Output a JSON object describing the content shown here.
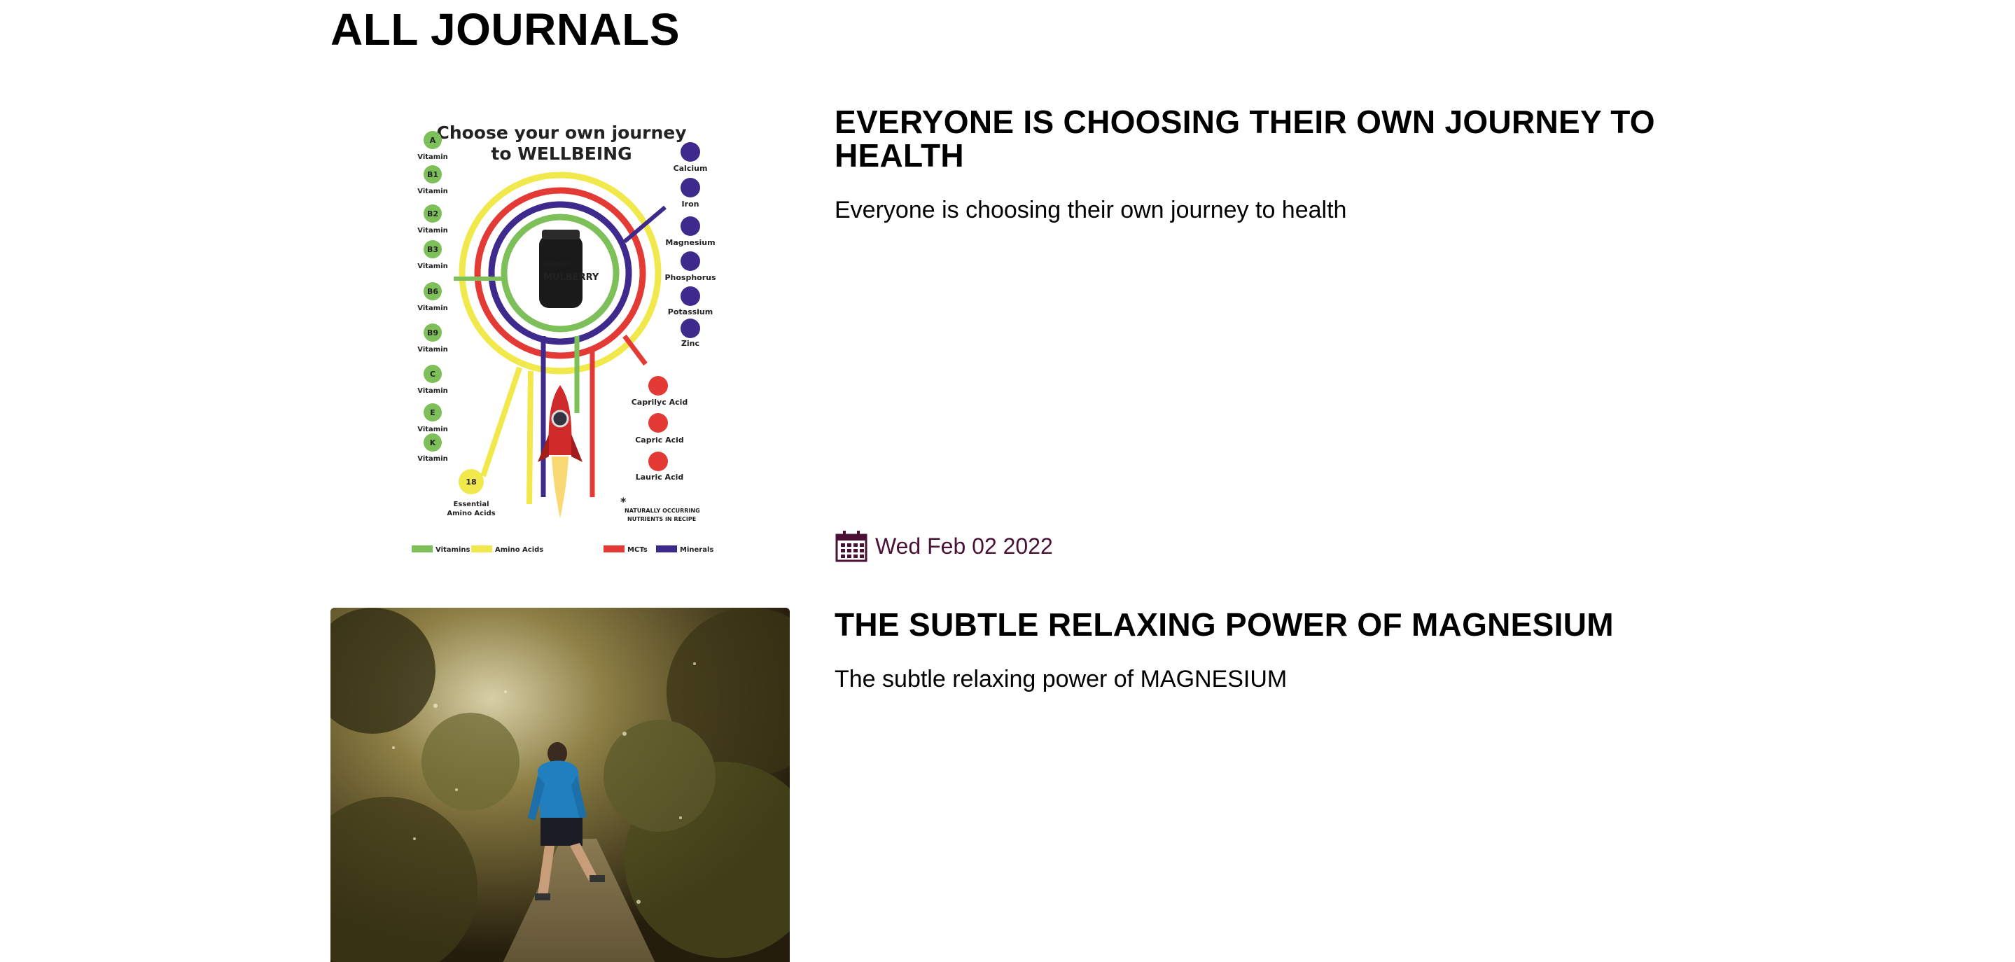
{
  "page": {
    "title": "ALL JOURNALS"
  },
  "articles": [
    {
      "title": "EVERYONE IS CHOOSING THEIR OWN JOURNEY TO HEALTH",
      "excerpt": "Everyone is choosing their own journey to health",
      "date": "Wed Feb 02 2022",
      "date_icon": "calendar-icon",
      "image": {
        "kind": "infographic",
        "heading_line1": "Choose your own journey",
        "heading_line2": "to WELLBEING",
        "product_label_1": "PREMIUM",
        "product_label_2": "MULBERRY",
        "vitamins": [
          {
            "code": "A",
            "label": "Vitamin"
          },
          {
            "code": "B1",
            "label": "Vitamin"
          },
          {
            "code": "B2",
            "label": "Vitamin"
          },
          {
            "code": "B3",
            "label": "Vitamin"
          },
          {
            "code": "B6",
            "label": "Vitamin"
          },
          {
            "code": "B9",
            "label": "Vitamin"
          },
          {
            "code": "C",
            "label": "Vitamin"
          },
          {
            "code": "E",
            "label": "Vitamin"
          },
          {
            "code": "K",
            "label": "Vitamin"
          }
        ],
        "minerals": [
          "Calcium",
          "Iron",
          "Magnesium",
          "Phosphorus",
          "Potassium",
          "Zinc"
        ],
        "mcts": [
          "Caprilyc Acid",
          "Capric Acid",
          "Lauric Acid"
        ],
        "amino": {
          "count": "18",
          "label_line1": "Essential",
          "label_line2": "Amino Acids"
        },
        "note_star": "*",
        "note_line1": "NATURALLY OCCURRING",
        "note_line2": "NUTRIENTS IN RECIPE",
        "legend": [
          {
            "label": "Vitamins",
            "color": "#7dc05a"
          },
          {
            "label": "Amino Acids",
            "color": "#f1e84b"
          },
          {
            "label": "MCTs",
            "color": "#e33a36"
          },
          {
            "label": "Minerals",
            "color": "#3d2a8c"
          }
        ]
      }
    },
    {
      "title": "THE SUBTLE RELAXING POWER OF MAGNESIUM",
      "excerpt": "The subtle relaxing power of MAGNESIUM",
      "image": {
        "kind": "photo",
        "subject": "runner-on-forest-trail"
      }
    }
  ],
  "colors": {
    "date_text": "#4a1135",
    "vitamin_green": "#7dc05a",
    "amino_yellow": "#f1e84b",
    "mct_red": "#e33a36",
    "mineral_purple": "#3d2a8c"
  }
}
